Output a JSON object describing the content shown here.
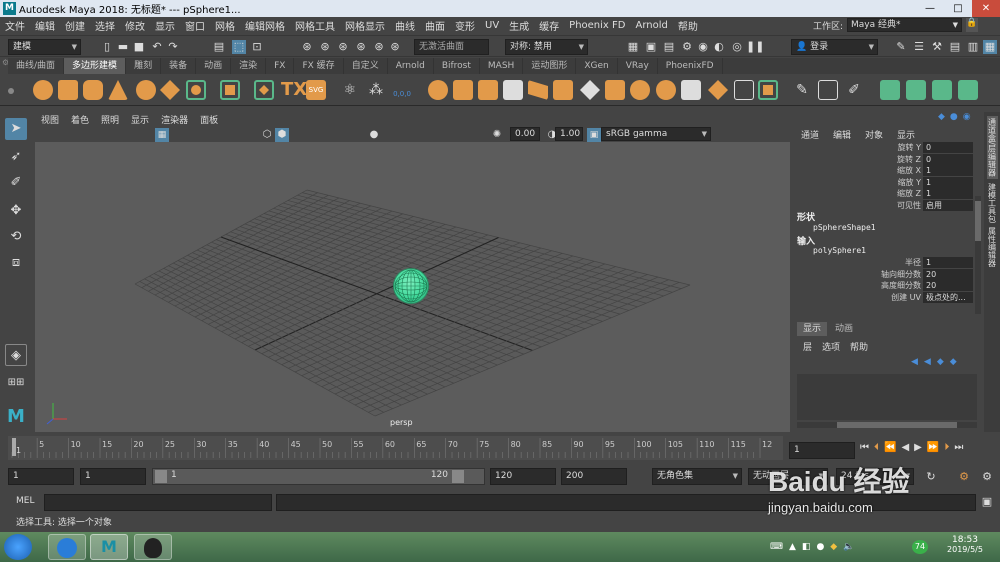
{
  "window": {
    "title": "Autodesk Maya 2018: 无标题*   ---   pSphere1...",
    "logo": "M",
    "minimize": "—",
    "maximize": "□",
    "close": "✕"
  },
  "menus": [
    "文件",
    "编辑",
    "创建",
    "选择",
    "修改",
    "显示",
    "窗口",
    "网格",
    "编辑网格",
    "网格工具",
    "网格显示",
    "曲线",
    "曲面",
    "变形",
    "UV",
    "生成",
    "缓存",
    "Phoenix FD",
    "Arnold",
    "帮助"
  ],
  "workspace": {
    "label": "工作区:",
    "value": "Maya 经典*"
  },
  "statusline": {
    "mode": "建模",
    "live_surface": "无激活曲面",
    "symmetry": "对称: 禁用",
    "login": "登录"
  },
  "shelf_tabs": [
    {
      "label": "曲线/曲面",
      "active": false
    },
    {
      "label": "多边形建模",
      "active": true
    },
    {
      "label": "雕刻",
      "active": false
    },
    {
      "label": "装备",
      "active": false
    },
    {
      "label": "动画",
      "active": false
    },
    {
      "label": "渲染",
      "active": false
    },
    {
      "label": "FX",
      "active": false
    },
    {
      "label": "FX 缓存",
      "active": false
    },
    {
      "label": "自定义",
      "active": false
    },
    {
      "label": "Arnold",
      "active": false
    },
    {
      "label": "Bifrost",
      "active": false
    },
    {
      "label": "MASH",
      "active": false
    },
    {
      "label": "运动图形",
      "active": false
    },
    {
      "label": "XGen",
      "active": false
    },
    {
      "label": "VRay",
      "active": false
    },
    {
      "label": "PhoenixFD",
      "active": false
    }
  ],
  "shelf_extra": {
    "tx": "TX",
    "svg": "SVG",
    "zeros": "0,0,0"
  },
  "viewport": {
    "menus": [
      "视图",
      "着色",
      "照明",
      "显示",
      "渲染器",
      "面板"
    ],
    "exposure": "0.00",
    "gamma": "1.00",
    "colorspace": "sRGB gamma",
    "camera": "persp"
  },
  "channel_box": {
    "tabs": [
      "通道",
      "编辑",
      "对象",
      "显示"
    ],
    "rows": [
      {
        "label": "旋转 Y",
        "value": "0"
      },
      {
        "label": "旋转 Z",
        "value": "0"
      },
      {
        "label": "缩放 X",
        "value": "1"
      },
      {
        "label": "缩放 Y",
        "value": "1"
      },
      {
        "label": "缩放 Z",
        "value": "1"
      },
      {
        "label": "可见性",
        "value": "启用"
      }
    ],
    "shapes_header": "形状",
    "shape_name": "pSphereShape1",
    "inputs_header": "输入",
    "input_name": "polySphere1",
    "input_rows": [
      {
        "label": "半径",
        "value": "1"
      },
      {
        "label": "轴向细分数",
        "value": "20"
      },
      {
        "label": "高度细分数",
        "value": "20"
      },
      {
        "label": "创建 UV",
        "value": "极点处的..."
      }
    ]
  },
  "layer_editor": {
    "tabs": [
      "显示",
      "动画"
    ],
    "menus": [
      "层",
      "选项",
      "帮助"
    ]
  },
  "side_tabs": [
    "通道盒/层编辑器",
    "建模工具包",
    "属性编辑器"
  ],
  "timeline": {
    "ticks": [
      "5",
      "10",
      "15",
      "20",
      "25",
      "30",
      "35",
      "40",
      "45",
      "50",
      "55",
      "60",
      "65",
      "70",
      "75",
      "80",
      "85",
      "90",
      "95",
      "100",
      "105",
      "110",
      "115",
      "12"
    ],
    "current_frame": "1",
    "start_marker": "1"
  },
  "range": {
    "start": "1",
    "anim_start": "1",
    "slider_start": "1",
    "slider_end": "120",
    "anim_end": "120",
    "end": "200",
    "char_set": "无角色集",
    "anim_layer": "无动画层",
    "fps": "24 fps"
  },
  "command": {
    "label": "MEL"
  },
  "help_line": "选择工具: 选择一个对象",
  "taskbar": {
    "time": "18:53",
    "date": "2019/5/5",
    "badge": "74"
  },
  "watermark": {
    "brand": "Baidu 经验",
    "url": "jingyan.baidu.com"
  },
  "colors": {
    "accent": "#5285a6",
    "shelf_orange": "#e29a4a",
    "shelf_green": "#5ab88a",
    "sphere": "#3fd99a"
  }
}
